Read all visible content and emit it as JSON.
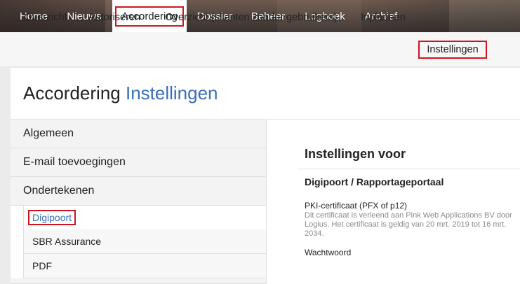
{
  "topnav": {
    "items": [
      {
        "label": "Home"
      },
      {
        "label": "Nieuws"
      },
      {
        "label": "Accordering"
      },
      {
        "label": "Dossier"
      },
      {
        "label": "Beheer"
      },
      {
        "label": "Logboek"
      },
      {
        "label": "Archief"
      }
    ],
    "active": "Accordering"
  },
  "subnav": {
    "items": [
      {
        "label": "Overzicht"
      },
      {
        "label": "Autoriseren"
      },
      {
        "label": "Overzicht (clienten zonder gebruikers)"
      },
      {
        "label": "Inplannen"
      },
      {
        "label": "Instellingen"
      }
    ],
    "active": "Instellingen"
  },
  "page": {
    "title_main": "Accordering",
    "title_accent": "Instellingen"
  },
  "leftmenu": {
    "items": [
      {
        "label": "Algemeen"
      },
      {
        "label": "E-mail toevoegingen"
      },
      {
        "label": "Ondertekenen"
      }
    ],
    "subitems": [
      {
        "label": "Digipoort"
      },
      {
        "label": "SBR Assurance"
      },
      {
        "label": "PDF"
      }
    ],
    "selected": "Digipoort"
  },
  "rightpanel": {
    "heading": "Instellingen voor",
    "subheading": "Digipoort / Rapportageportaal",
    "cert_label": "PKI-certificaat (PFX of p12)",
    "cert_desc": "Dit certificaat is verleend aan Pink Web Applications BV door Logius. Het certificaat is geldig van 20 mrt. 2019 tot 16 mrt. 2034.",
    "password_label": "Wachtwoord"
  },
  "colors": {
    "accent": "#3a6ebd",
    "highlight_border": "#d0161d"
  }
}
